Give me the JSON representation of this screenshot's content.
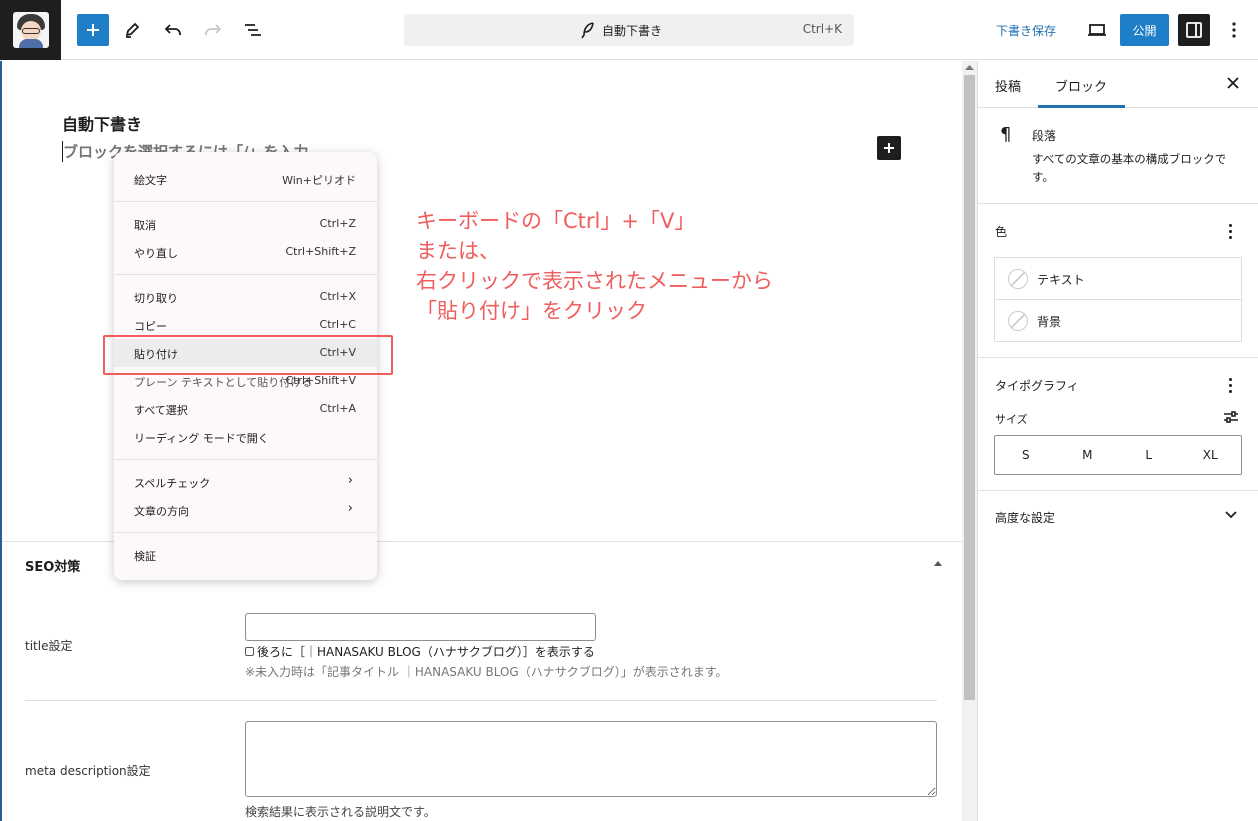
{
  "topbar": {
    "doc_title": "自動下書き",
    "shortcut": "Ctrl+K",
    "save_draft": "下書き保存",
    "publish": "公開"
  },
  "editor": {
    "post_title": "自動下書き",
    "placeholder": "ブロックを選択するには「/」を入力"
  },
  "annotation": {
    "line1": "キーボードの「Ctrl」+「V」",
    "line2": "または、",
    "line3": "右クリックで表示されたメニューから",
    "line4": "「貼り付け」をクリック"
  },
  "context_menu": {
    "items": [
      {
        "label": "絵文字",
        "shortcut": "Win+ピリオド"
      },
      {
        "label": "取消",
        "shortcut": "Ctrl+Z"
      },
      {
        "label": "やり直し",
        "shortcut": "Ctrl+Shift+Z"
      },
      {
        "label": "切り取り",
        "shortcut": "Ctrl+X"
      },
      {
        "label": "コピー",
        "shortcut": "Ctrl+C"
      },
      {
        "label": "貼り付け",
        "shortcut": "Ctrl+V"
      },
      {
        "label": "プレーン テキストとして貼り付ける",
        "shortcut": "Ctrl+Shift+V"
      },
      {
        "label": "すべて選択",
        "shortcut": "Ctrl+A"
      },
      {
        "label": "リーディング モードで開く",
        "shortcut": ""
      },
      {
        "label": "スペルチェック",
        "shortcut": ""
      },
      {
        "label": "文章の方向",
        "shortcut": ""
      },
      {
        "label": "検証",
        "shortcut": ""
      }
    ]
  },
  "seo": {
    "heading": "SEO対策",
    "title_label": "title設定",
    "title_value": "",
    "append_label": "後ろに［｜HANASAKU BLOG（ハナサクブログ）］を表示する",
    "note": "※未入力時は「記事タイトル ｜HANASAKU BLOG（ハナサクブログ）」が表示されます。",
    "meta_label": "meta description設定",
    "meta_value": "",
    "meta_help": "検索結果に表示される説明文です。"
  },
  "sidebar": {
    "tab_post": "投稿",
    "tab_block": "ブロック",
    "block_name": "段落",
    "block_desc": "すべての文章の基本の構成ブロックです。",
    "color_title": "色",
    "color_text": "テキスト",
    "color_bg": "背景",
    "typo_title": "タイポグラフィ",
    "size_label": "サイズ",
    "sizes": [
      "S",
      "M",
      "L",
      "XL"
    ],
    "advanced": "高度な設定"
  },
  "colors": {
    "accent": "#1e7ec8",
    "annotation": "#ef5d5d",
    "dark": "#1e1e1e"
  },
  "icons": [
    "add-icon",
    "pen-icon",
    "undo-icon",
    "redo-icon",
    "list-view-icon",
    "feather-icon",
    "laptop-icon",
    "sidebar-icon",
    "kebab-icon",
    "close-icon",
    "pilcrow-icon",
    "chevron-down-icon",
    "sliders-icon"
  ]
}
